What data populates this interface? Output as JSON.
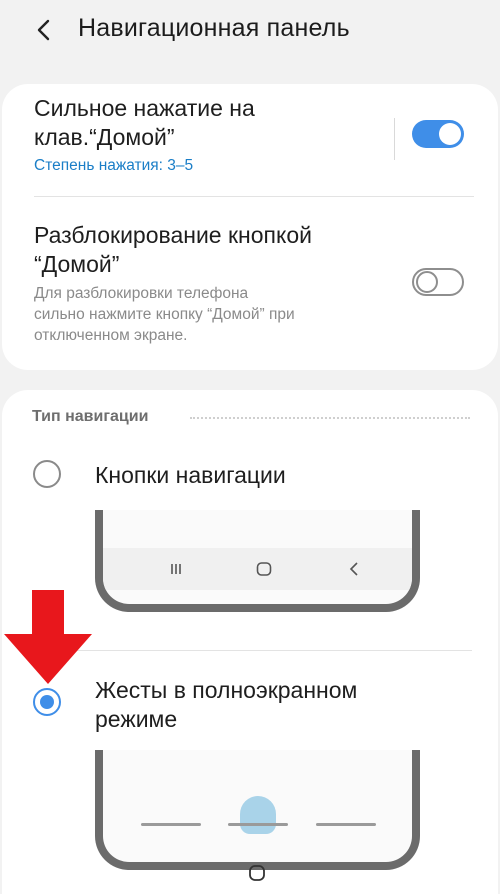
{
  "header": {
    "title": "Навигационная панель"
  },
  "settings": {
    "hard_press": {
      "title_line1": "Сильное нажатие на",
      "title_line2": "клав.“Домой”",
      "subtitle": "Степень нажатия: 3–5",
      "enabled": true
    },
    "unlock_home": {
      "title_line1": "Разблокирование кнопкой",
      "title_line2": "“Домой”",
      "desc_line1": "Для разблокировки телефона",
      "desc_line2": "сильно нажмите кнопку “Домой” при",
      "desc_line3": "отключенном экране.",
      "enabled": false
    }
  },
  "navigation_type": {
    "section_label": "Тип навигации",
    "options": [
      {
        "label_line1": "Кнопки навигации",
        "label_line2": "",
        "selected": false
      },
      {
        "label_line1": "Жесты в полноэкранном",
        "label_line2": "режиме",
        "selected": true
      }
    ]
  },
  "colors": {
    "accent": "#3f8ee8",
    "subtitle_blue": "#1a7ec7",
    "arrow_red": "#e8171c"
  }
}
